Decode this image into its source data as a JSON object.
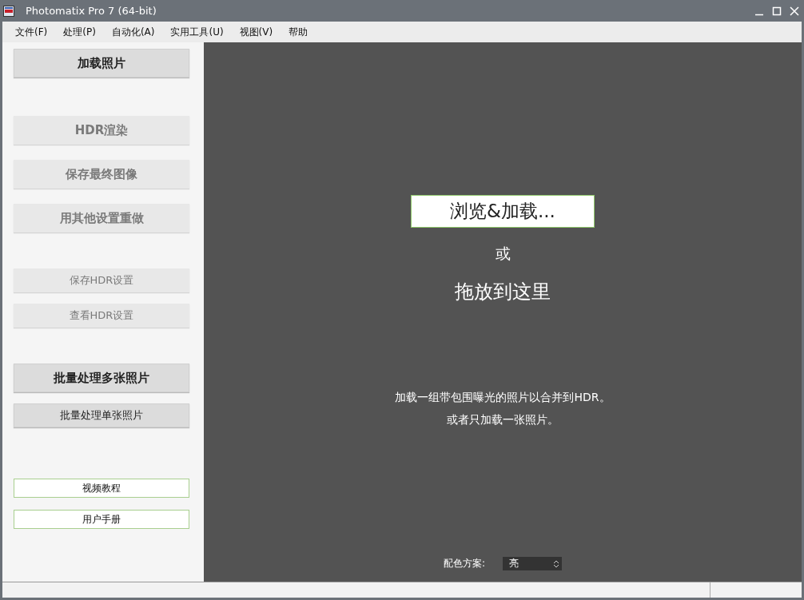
{
  "window": {
    "title": "Photomatix Pro 7  (64-bit)"
  },
  "menu": [
    "文件(F)",
    "处理(P)",
    "自动化(A)",
    "实用工具(U)",
    "视图(V)",
    "帮助"
  ],
  "sidebar": {
    "groups": [
      {
        "buttons": [
          {
            "label": "加载照片",
            "kind": "large",
            "disabled": false
          }
        ]
      },
      {
        "buttons": [
          {
            "label": "HDR渲染",
            "kind": "large",
            "disabled": true
          },
          {
            "label": "保存最终图像",
            "kind": "large",
            "disabled": true
          },
          {
            "label": "用其他设置重做",
            "kind": "large",
            "disabled": true
          }
        ]
      },
      {
        "buttons": [
          {
            "label": "保存HDR设置",
            "kind": "small",
            "disabled": true
          },
          {
            "label": "查看HDR设置",
            "kind": "small",
            "disabled": true
          }
        ]
      },
      {
        "buttons": [
          {
            "label": "批量处理多张照片",
            "kind": "large",
            "disabled": false
          },
          {
            "label": "批量处理单张照片",
            "kind": "small",
            "disabled": false
          }
        ]
      },
      {
        "buttons": [
          {
            "label": "视频教程",
            "kind": "link",
            "disabled": false
          },
          {
            "label": "用户手册",
            "kind": "link",
            "disabled": false
          }
        ]
      }
    ]
  },
  "drop_area": {
    "browse_button": "浏览&加载...",
    "or": "或",
    "drop_text": "拖放到这里",
    "hints": [
      "加载一组带包围曝光的照片以合并到HDR。",
      "或者只加载一张照片。"
    ]
  },
  "color_scheme": {
    "label": "配色方案:",
    "value": "亮"
  }
}
